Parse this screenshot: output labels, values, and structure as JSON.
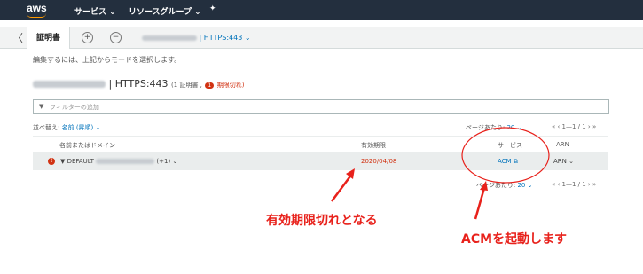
{
  "topnav": {
    "logo": "aws",
    "services": "サービス ⌄",
    "resource_groups": "リソースグループ ⌄",
    "pin": "✦"
  },
  "tabbar": {
    "back": "〈",
    "tab": "証明書",
    "add": "+",
    "remove": "−",
    "breadcrumb": "| HTTPS:443 ⌄"
  },
  "info": "編集するには、上記からモードを選択します。",
  "listener": {
    "title": "| HTTPS:443",
    "count": "(1 証明書 ,",
    "badge": "1",
    "expired": "期限切れ)"
  },
  "filter": {
    "icon": "▼",
    "placeholder": "フィルターの追加"
  },
  "sort": {
    "label": "並べ替え:",
    "value": "名前 (昇順) ⌄"
  },
  "pagination": {
    "per_page_label": "ページあたり:",
    "per_page": "20 ⌄",
    "pages": "« ‹ 1—1 / 1 › »"
  },
  "table": {
    "headers": [
      "名前またはドメイン",
      "有効期限",
      "サービス",
      "ARN"
    ],
    "rows": [
      {
        "status": "!",
        "name": "▼ DEFAULT",
        "extra": "(+1) ⌄",
        "expiry": "2020/04/08",
        "service": "ACM ⧉",
        "arn": "ARN ⌄"
      }
    ]
  },
  "annotations": {
    "expiry_note": "有効期限切れとなる",
    "acm_note": "ACMを起動します",
    "color": "#e8211b"
  }
}
